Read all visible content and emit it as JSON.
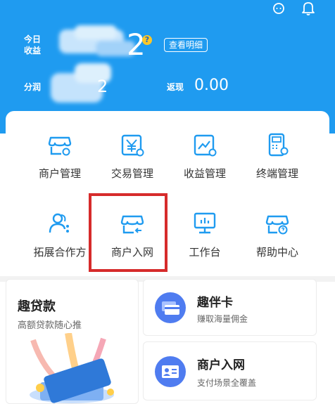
{
  "header": {
    "earnings_label_line1": "今日",
    "earnings_label_line2": "收益",
    "earnings_value": "2",
    "earnings_hint": "?",
    "detail_button": "查看明细",
    "share_label": "分润",
    "share_value": "2",
    "cashback_label": "返现",
    "cashback_value": "0.00"
  },
  "menu": [
    {
      "label": "商户管理",
      "icon": "merchant-manage-icon"
    },
    {
      "label": "交易管理",
      "icon": "trade-manage-icon"
    },
    {
      "label": "收益管理",
      "icon": "income-manage-icon"
    },
    {
      "label": "终端管理",
      "icon": "terminal-manage-icon"
    },
    {
      "label": "拓展合作方",
      "icon": "partner-expand-icon"
    },
    {
      "label": "商户入网",
      "icon": "merchant-join-icon"
    },
    {
      "label": "工作台",
      "icon": "workbench-icon"
    },
    {
      "label": "帮助中心",
      "icon": "help-center-icon"
    }
  ],
  "promos": {
    "loan": {
      "title": "趣贷款",
      "subtitle": "高额贷款随心推"
    },
    "card": {
      "title": "趣伴卡",
      "subtitle": "赚取海量佣金"
    },
    "join": {
      "title": "商户入网",
      "subtitle": "支付场景全覆盖"
    }
  },
  "colors": {
    "brand": "#1f9bf0",
    "highlight": "#d62b2b"
  }
}
